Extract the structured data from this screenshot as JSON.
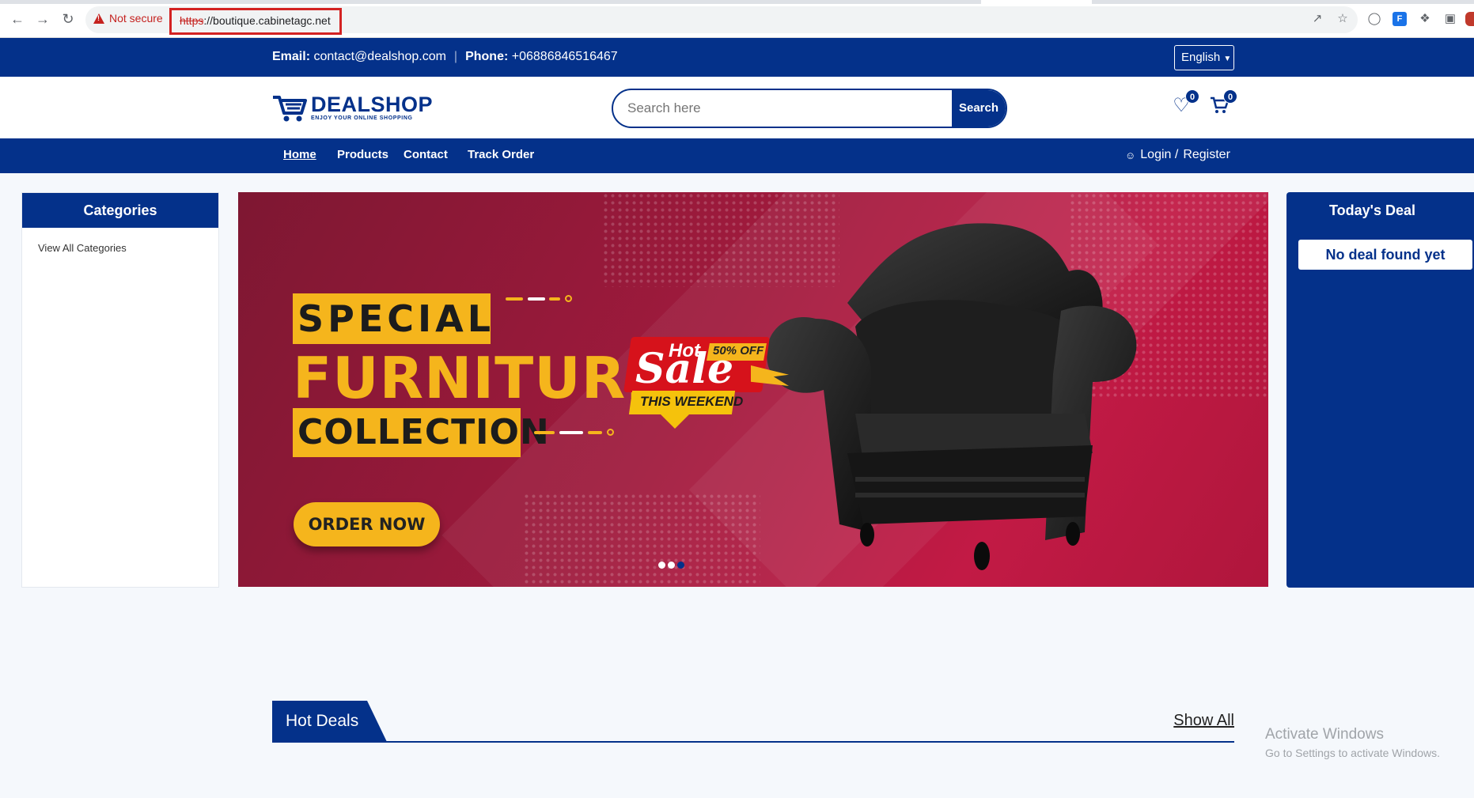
{
  "browser": {
    "security_label": "Not secure",
    "url_scheme": "https",
    "url_rest": "://boutique.cabinetagc.net"
  },
  "topbar": {
    "email_label": "Email:",
    "email": "contact@dealshop.com",
    "phone_label": "Phone:",
    "phone": "+06886846516467",
    "language": "English"
  },
  "header": {
    "logo_main": "DEALSHOP",
    "logo_tagline": "ENJOY YOUR ONLINE SHOPPING",
    "search_placeholder": "Search here",
    "search_button": "Search",
    "wishlist_count": "0",
    "cart_count": "0"
  },
  "nav": {
    "items": [
      "Home",
      "Products",
      "Contact",
      "Track Order"
    ],
    "login": "Login /",
    "register": "Register"
  },
  "categories": {
    "title": "Categories",
    "view_all": "View All Categories"
  },
  "banner": {
    "line1": "SPECIAL",
    "line2": "FURNITURE",
    "line3": "COLLECTION",
    "cta": "ORDER NOW",
    "sale_hot": "Hot",
    "sale_word": "Sale",
    "sale_off": "50% OFF",
    "sale_when": "THIS WEEKEND",
    "active_slide": 3,
    "slides": 3
  },
  "deal": {
    "title": "Today's Deal",
    "empty": "No deal found yet"
  },
  "hot_deals": {
    "title": "Hot Deals",
    "show_all": "Show All"
  },
  "windows": {
    "line1": "Activate Windows",
    "line2": "Go to Settings to activate Windows."
  },
  "colors": {
    "brand": "#04318a",
    "accent": "#f5b51c",
    "banner": "#a01a3d"
  }
}
